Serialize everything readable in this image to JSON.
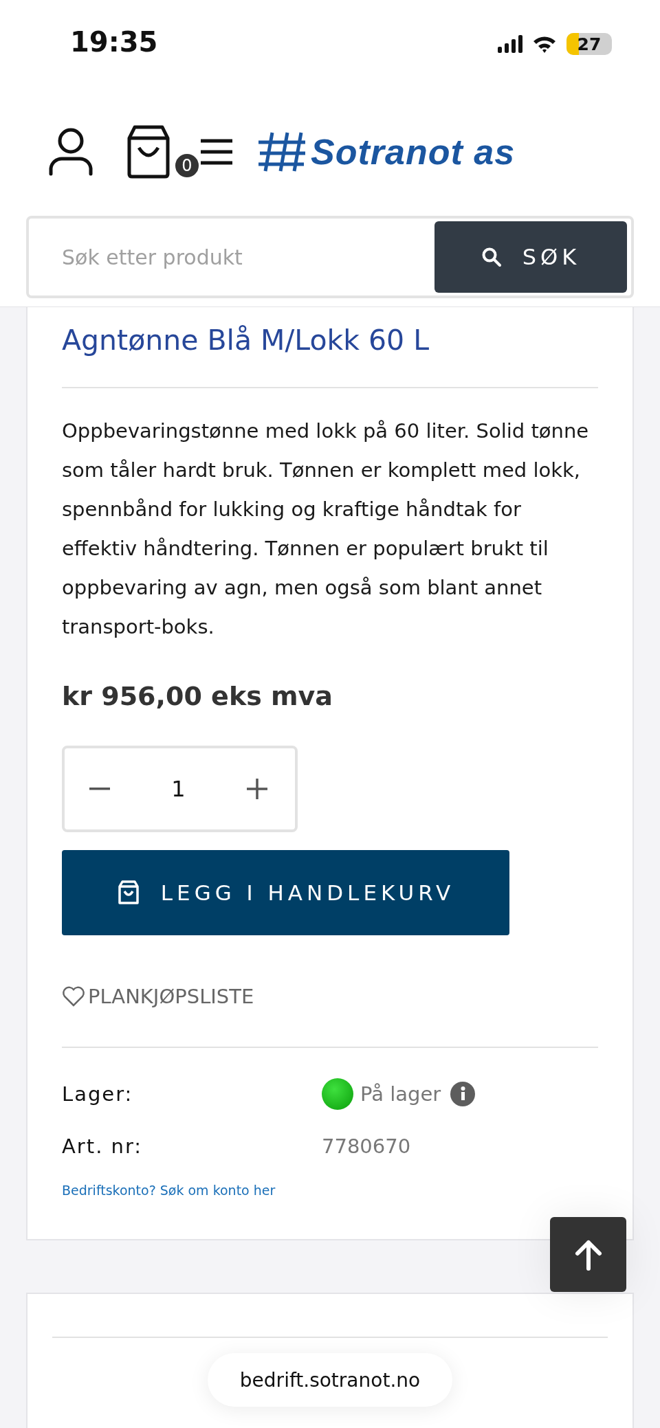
{
  "status_bar": {
    "time": "19:35",
    "battery": "27"
  },
  "header": {
    "cart_count": "0",
    "logo": "Sotranot as"
  },
  "search": {
    "placeholder": "Søk etter produkt",
    "button": "SØK"
  },
  "product": {
    "title": "Agntønne Blå M/Lokk 60 L",
    "description": "Oppbevaringstønne med lokk på 60 liter. Solid tønne som tåler hardt bruk. Tønnen er komplett med lokk, spennbånd for lukking og kraftige håndtak for effektiv håndtering. Tønnen er populært brukt til oppbevaring av agn, men også som blant annet transport-boks.",
    "price": "kr 956,00 eks mva",
    "quantity": "1",
    "add_to_cart": "LEGG I HANDLEKURV",
    "wishlist": "PLANKJØPSLISTE",
    "details": [
      {
        "label": "Lager:",
        "value": "På lager",
        "kind": "stock"
      },
      {
        "label": "Art. nr:",
        "value": "7780670",
        "kind": "text"
      }
    ],
    "account_link": "Bedriftskonto? Søk om konto her"
  },
  "browser": {
    "url": "bedrift.sotranot.no"
  }
}
